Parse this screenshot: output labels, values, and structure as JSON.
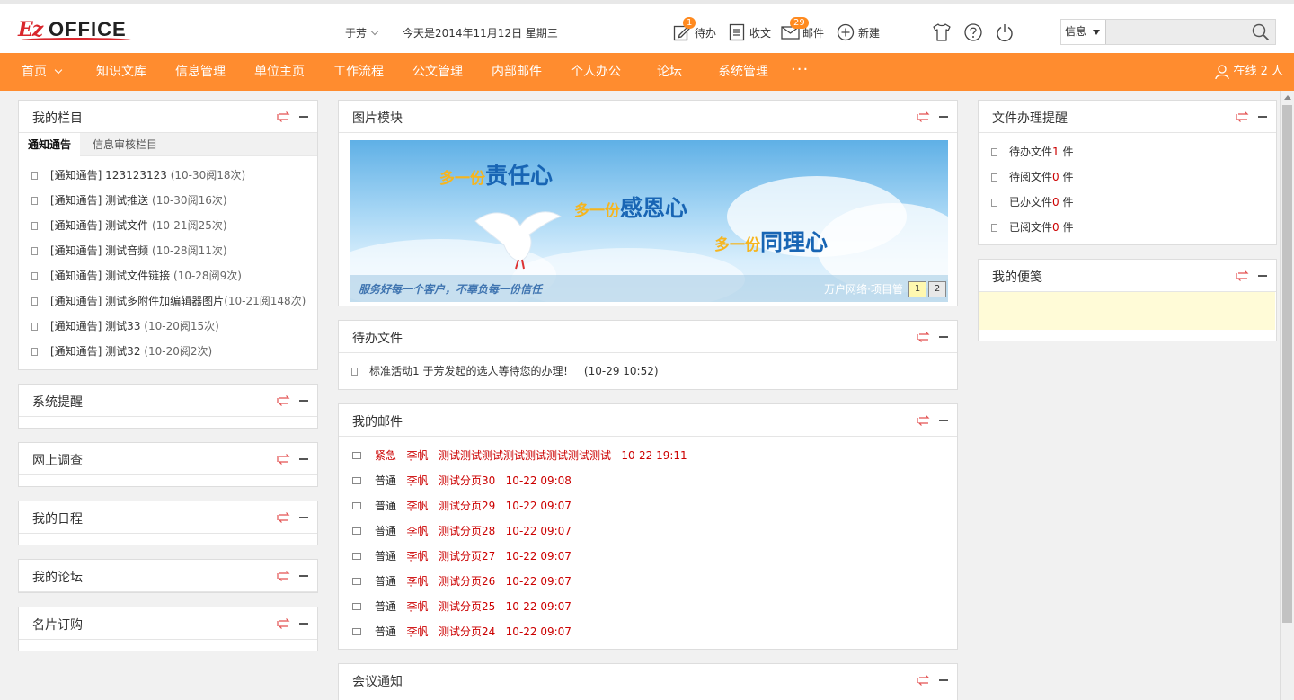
{
  "header": {
    "logo_text_ez": "Ez",
    "logo_text_office": "OFFICE",
    "username": "于芳",
    "date_text": "今天是2014年11月12日 星期三",
    "tools": [
      {
        "label": "待办",
        "icon": "edit-icon",
        "badge": "1"
      },
      {
        "label": "收文",
        "icon": "document-icon",
        "badge": ""
      },
      {
        "label": "邮件",
        "icon": "mail-icon",
        "badge": "29"
      },
      {
        "label": "新建",
        "icon": "plus-circle-icon",
        "badge": ""
      }
    ],
    "search": {
      "select_value": "信息",
      "placeholder": ""
    }
  },
  "nav": {
    "items": [
      "首页",
      "知识文库",
      "信息管理",
      "单位主页",
      "工作流程",
      "公文管理",
      "内部邮件",
      "个人办公",
      "论坛",
      "系统管理"
    ],
    "more": "···",
    "online": "在线 2 人"
  },
  "left": {
    "my_columns": {
      "title": "我的栏目",
      "tabs": [
        "通知通告",
        "信息审核栏目"
      ],
      "items": [
        {
          "title": "[通知通告] 123123123",
          "meta": "(10-30阅18次)"
        },
        {
          "title": "[通知通告] 测试推送",
          "meta": "(10-30阅16次)"
        },
        {
          "title": "[通知通告] 测试文件",
          "meta": "(10-21阅25次)"
        },
        {
          "title": "[通知通告] 测试音频",
          "meta": "(10-28阅11次)"
        },
        {
          "title": "[通知通告] 测试文件链接",
          "meta": "(10-28阅9次)"
        },
        {
          "title": "[通知通告] 测试多附件加编辑器图片",
          "meta": "(10-21阅148次)"
        },
        {
          "title": "[通知通告] 测试33",
          "meta": "(10-20阅15次)"
        },
        {
          "title": "[通知通告] 测试32",
          "meta": "(10-20阅2次)"
        }
      ]
    },
    "panels": [
      "系统提醒",
      "网上调查",
      "我的日程",
      "我的论坛",
      "名片订购"
    ]
  },
  "middle": {
    "image_module": {
      "title": "图片模块",
      "banner": {
        "line1_small": "多一份",
        "line1_big": "责任心",
        "line2_small": "多一份",
        "line2_big": "感恩心",
        "line3_small": "多一份",
        "line3_big": "同理心",
        "slogan": "服务好每一个客户，不辜负每一份信任",
        "brand": "万户网络·项目管",
        "pages": [
          "1",
          "2"
        ]
      }
    },
    "todo": {
      "title": "待办文件",
      "items": [
        {
          "text": "标准活动1  于芳发起的选人等待您的办理！",
          "time": "(10-29 10:52)"
        }
      ]
    },
    "mail": {
      "title": "我的邮件",
      "items": [
        {
          "level": "紧急",
          "from": "李帆",
          "subject": "测试测试测试测试测试测试测试测试",
          "time": "10-22 19:11"
        },
        {
          "level": "普通",
          "from": "李帆",
          "subject": "测试分页30",
          "time": "10-22 09:08"
        },
        {
          "level": "普通",
          "from": "李帆",
          "subject": "测试分页29",
          "time": "10-22 09:07"
        },
        {
          "level": "普通",
          "from": "李帆",
          "subject": "测试分页28",
          "time": "10-22 09:07"
        },
        {
          "level": "普通",
          "from": "李帆",
          "subject": "测试分页27",
          "time": "10-22 09:07"
        },
        {
          "level": "普通",
          "from": "李帆",
          "subject": "测试分页26",
          "time": "10-22 09:07"
        },
        {
          "level": "普通",
          "from": "李帆",
          "subject": "测试分页25",
          "time": "10-22 09:07"
        },
        {
          "level": "普通",
          "from": "李帆",
          "subject": "测试分页24",
          "time": "10-22 09:07"
        }
      ]
    },
    "meeting": {
      "title": "会议通知"
    }
  },
  "right": {
    "file_reminder": {
      "title": "文件办理提醒",
      "items": [
        {
          "label": "待办文件",
          "count": "1",
          "unit": "件"
        },
        {
          "label": "待阅文件",
          "count": "0",
          "unit": "件"
        },
        {
          "label": "已办文件",
          "count": "0",
          "unit": "件"
        },
        {
          "label": "已阅文件",
          "count": "0",
          "unit": "件"
        }
      ]
    },
    "notes": {
      "title": "我的便笺"
    }
  },
  "colors": {
    "accent": "#ff8c2f",
    "badge": "#ff8a1f",
    "urgent": "#cc0000",
    "note_bg": "#fffbd7"
  }
}
